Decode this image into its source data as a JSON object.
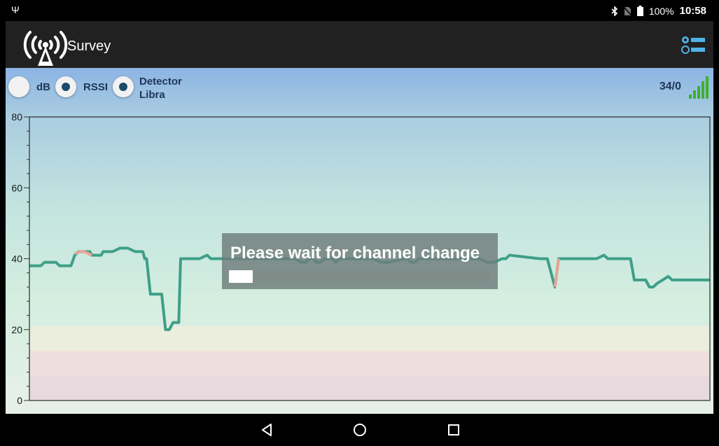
{
  "status_bar": {
    "usb_icon": "usb-icon",
    "bluetooth_icon": "bluetooth-icon",
    "no_sim_icon": "no-sim-icon",
    "battery_icon": "battery-icon",
    "battery": "100%",
    "time": "10:58"
  },
  "app_bar": {
    "title": "Survey",
    "logo_icon": "radio-tower-icon",
    "menu_icon": "options-list-icon"
  },
  "controls": {
    "radios": [
      {
        "label": "dB",
        "selected": false
      },
      {
        "label": "RSSI",
        "selected": true
      },
      {
        "label_line1": "Detector",
        "label_line2": "Libra",
        "selected": true
      }
    ],
    "count": "34/0",
    "signal_icon": "signal-strength-icon"
  },
  "chart_data": {
    "type": "line",
    "title": "",
    "xlabel": "",
    "ylabel": "",
    "ylim": [
      0,
      80
    ],
    "yticks": [
      0,
      20,
      40,
      60,
      80
    ],
    "grid": false,
    "bands": [
      {
        "from": 0,
        "to": 7,
        "color": "#e6dadf"
      },
      {
        "from": 7,
        "to": 14,
        "color": "#efdfdc"
      },
      {
        "from": 14,
        "to": 21,
        "color": "#ebeedd"
      }
    ],
    "series": [
      {
        "color": "#3e9f88",
        "x": [
          0,
          3,
          4,
          7,
          8,
          11,
          12,
          13,
          14,
          16,
          16.5,
          19,
          19.5,
          22,
          24,
          26,
          28,
          29,
          30,
          30.5,
          31,
          32,
          32.5,
          35,
          36,
          37,
          38,
          39,
          39.5,
          40,
          45,
          47,
          48,
          70,
          72,
          73,
          74,
          75,
          76,
          77,
          78,
          80,
          81,
          82,
          91,
          93,
          95,
          99,
          100,
          101,
          102,
          103,
          104,
          105,
          119,
          121,
          123,
          125,
          126,
          127,
          135,
          137,
          139,
          140,
          150,
          152,
          153,
          157,
          158,
          159,
          160,
          163,
          164,
          165,
          166,
          169,
          170,
          171,
          175,
          180
        ],
        "y": [
          38,
          38,
          39,
          39,
          38,
          38,
          41,
          42,
          42,
          42,
          41,
          41,
          42,
          42,
          43,
          43,
          42,
          42,
          42,
          40,
          40,
          30,
          30,
          30,
          20,
          20,
          22,
          22,
          22,
          40,
          40,
          41,
          40,
          40,
          39,
          39,
          40,
          40,
          39,
          39,
          40,
          40,
          39,
          40,
          40,
          39,
          39,
          40,
          40,
          39,
          39,
          40,
          40,
          40,
          40,
          39,
          39,
          40,
          40,
          41,
          40,
          40,
          32,
          40,
          40,
          41,
          40,
          40,
          40,
          40,
          34,
          34,
          32,
          32,
          33,
          35,
          34,
          34,
          34,
          34
        ]
      },
      {
        "color": "#e8a496",
        "segments": [
          {
            "x": [
              12,
              13.5,
              14.5,
              15.5,
              16.5
            ],
            "y": [
              41.5,
              42,
              42,
              41.5,
              41
            ]
          },
          {
            "x": [
              139,
              140
            ],
            "y": [
              32,
              40
            ]
          }
        ]
      }
    ]
  },
  "dialog": {
    "message": "Please wait for channel change",
    "progress": 0.09
  },
  "nav_bar": {
    "back_icon": "back-triangle-icon",
    "home_icon": "home-circle-icon",
    "recents_icon": "recents-square-icon"
  }
}
